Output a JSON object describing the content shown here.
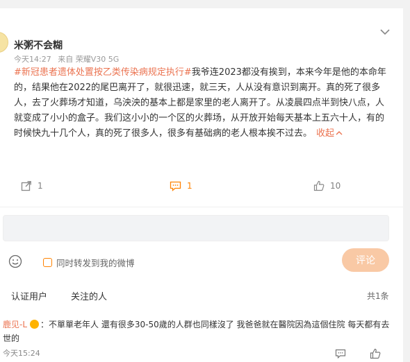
{
  "post": {
    "author": "米粥不会糊",
    "time": "今天14:27",
    "source": "来自 荣耀V30 5G",
    "hashtag": "#新冠患者遗体处置按乙类传染病规定执行#",
    "text": "我爷连2023都没有挨到，本来今年是他的本命年的，结果他在2022的尾巴离开了，就很迅速，就三天，人从没有意识到离开。真的死了很多人，去了火葬场才知道，乌泱泱的基本上都是家里的老人离开了。从凌晨四点半到快八点，人就变成了小小的盒子。我们这小小的一个区的火葬场，从开放开始每天基本上五六十人，有的时候快九十几个人，真的死了很多人，很多有基础病的老人根本挨不过去。",
    "collapse_label": "收起"
  },
  "actions": {
    "repost_count": "1",
    "comment_count": "1",
    "like_count": "10"
  },
  "composer": {
    "repost_label": "同时转发到我的微博",
    "submit_label": "评论"
  },
  "filters": {
    "verified": "认证用户",
    "following": "关注的人",
    "total": "共1条"
  },
  "comment": {
    "user": "鹿见-L",
    "text": "：不單單老年人 還有很多30-50歲的人群也同樣沒了 我爸爸就在醫院因為這個住院 每天都有去世的",
    "time": "今天15:24"
  },
  "colors": {
    "accent": "#ff8200",
    "link": "#eb7350",
    "submit_bg": "#f9c9a5"
  }
}
